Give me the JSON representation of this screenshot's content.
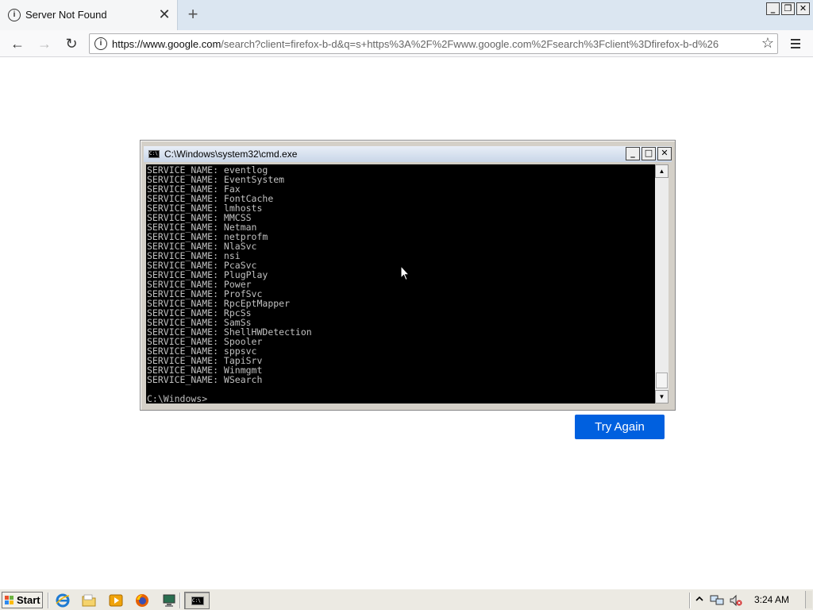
{
  "browser": {
    "tab_title": "Server Not Found",
    "tab_close_glyph": "✕",
    "new_tab_glyph": "+",
    "back_glyph": "←",
    "forward_glyph": "→",
    "reload_glyph": "↻",
    "url_host": "https://www.google.com",
    "url_rest": "/search?client=firefox-b-d&q=s+https%3A%2F%2Fwww.google.com%2Fsearch%3Fclient%3Dfirefox-b-d%26",
    "window_buttons": [
      "_",
      "❐",
      "✕"
    ]
  },
  "page": {
    "try_again_label": "Try Again",
    "accent": "#0060df"
  },
  "cmd": {
    "title": "C:\\Windows\\system32\\cmd.exe",
    "icon_text": "C:\\",
    "window_buttons": [
      "_",
      "□",
      "✕"
    ],
    "lines": [
      "SERVICE_NAME: eventlog",
      "SERVICE_NAME: EventSystem",
      "SERVICE_NAME: Fax",
      "SERVICE_NAME: FontCache",
      "SERVICE_NAME: lmhosts",
      "SERVICE_NAME: MMCSS",
      "SERVICE_NAME: Netman",
      "SERVICE_NAME: netprofm",
      "SERVICE_NAME: NlaSvc",
      "SERVICE_NAME: nsi",
      "SERVICE_NAME: PcaSvc",
      "SERVICE_NAME: PlugPlay",
      "SERVICE_NAME: Power",
      "SERVICE_NAME: ProfSvc",
      "SERVICE_NAME: RpcEptMapper",
      "SERVICE_NAME: RpcSs",
      "SERVICE_NAME: SamSs",
      "SERVICE_NAME: ShellHWDetection",
      "SERVICE_NAME: Spooler",
      "SERVICE_NAME: sppsvc",
      "SERVICE_NAME: TapiSrv",
      "SERVICE_NAME: Winmgmt",
      "SERVICE_NAME: WSearch",
      "",
      "C:\\Windows>"
    ]
  },
  "taskbar": {
    "start_label": "Start",
    "clock": "3:24 AM",
    "quick_launch": [
      "internet-explorer-icon",
      "folder-icon",
      "media-player-icon",
      "firefox-icon",
      "remote-desktop-icon"
    ],
    "active_task_icon": "cmd-icon"
  }
}
